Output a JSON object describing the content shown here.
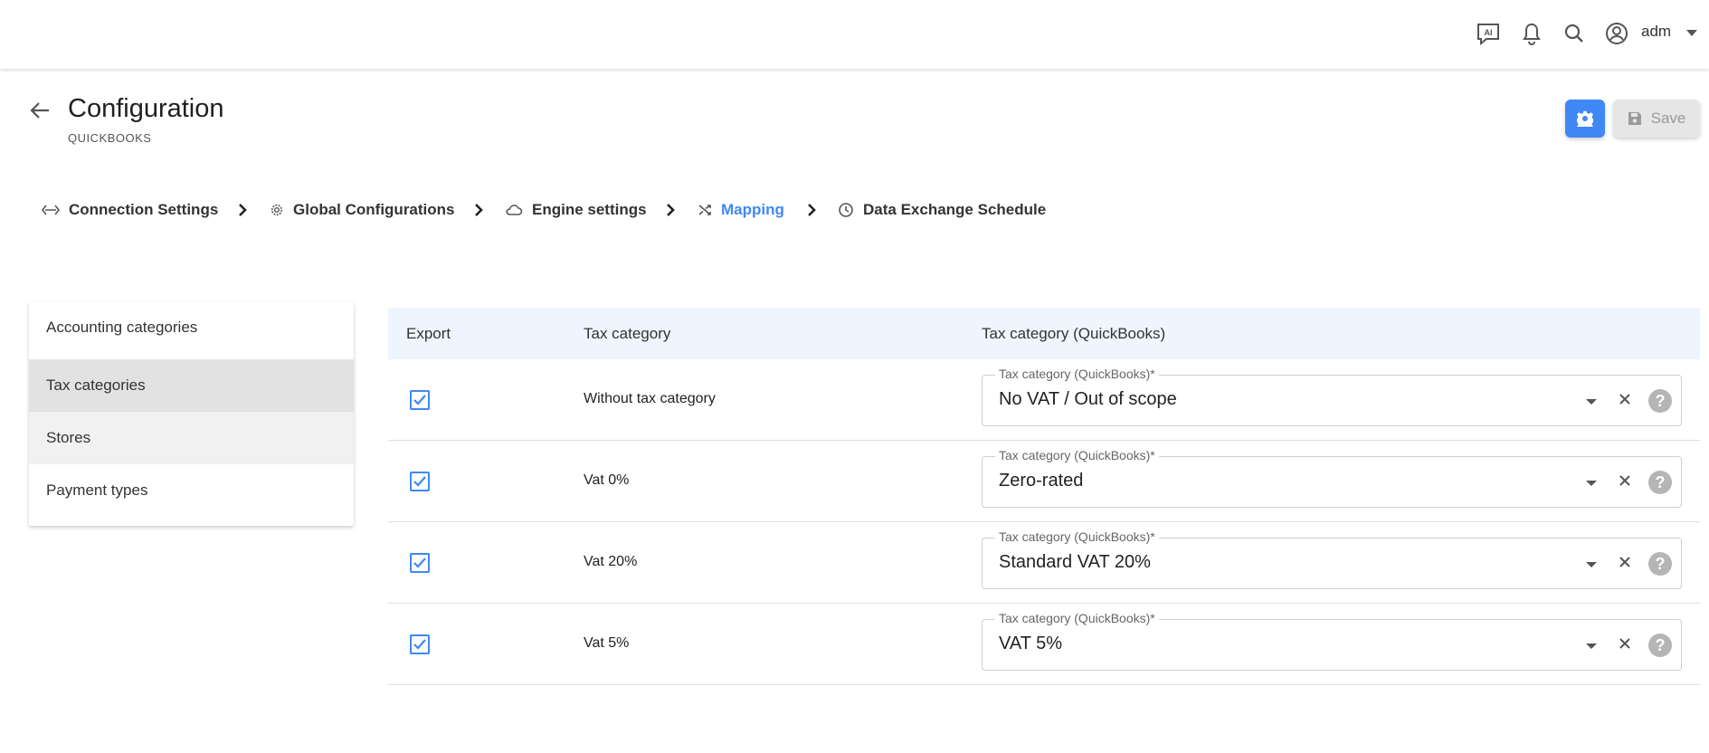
{
  "topbar": {
    "icons": [
      "ai-chat-icon",
      "bell-icon",
      "search-icon",
      "user-circle-icon"
    ],
    "user_name": "adm"
  },
  "header": {
    "title": "Configuration",
    "subtitle": "QUICKBOOKS",
    "save_label": "Save"
  },
  "stepper": {
    "steps": [
      {
        "label": "Connection Settings",
        "icon": "code-arrows-icon"
      },
      {
        "label": "Global Configurations",
        "icon": "gear-icon"
      },
      {
        "label": "Engine settings",
        "icon": "cloud-icon"
      },
      {
        "label": "Mapping",
        "icon": "shuffle-icon",
        "active": true
      },
      {
        "label": "Data Exchange Schedule",
        "icon": "clock-icon"
      }
    ]
  },
  "sidebar": {
    "items": [
      {
        "label": "Accounting categories"
      },
      {
        "label": "Tax categories",
        "selected": true
      },
      {
        "label": "Stores"
      },
      {
        "label": "Payment types"
      }
    ]
  },
  "table": {
    "headers": {
      "export": "Export",
      "tax_category": "Tax category",
      "tax_category_qb": "Tax category (QuickBooks)"
    },
    "field_label": "Tax category (QuickBooks)*",
    "rows": [
      {
        "checked": true,
        "tax_category": "Without tax category",
        "qb_value": "No VAT / Out of scope"
      },
      {
        "checked": true,
        "tax_category": "Vat 0%",
        "qb_value": "Zero-rated"
      },
      {
        "checked": true,
        "tax_category": "Vat 20%",
        "qb_value": "Standard VAT 20%"
      },
      {
        "checked": true,
        "tax_category": "Vat 5%",
        "qb_value": "VAT 5%"
      }
    ]
  },
  "colors": {
    "accent": "#3f88f5",
    "header_bg": "#eef5ff",
    "selected_bg": "#e2e2e2"
  }
}
